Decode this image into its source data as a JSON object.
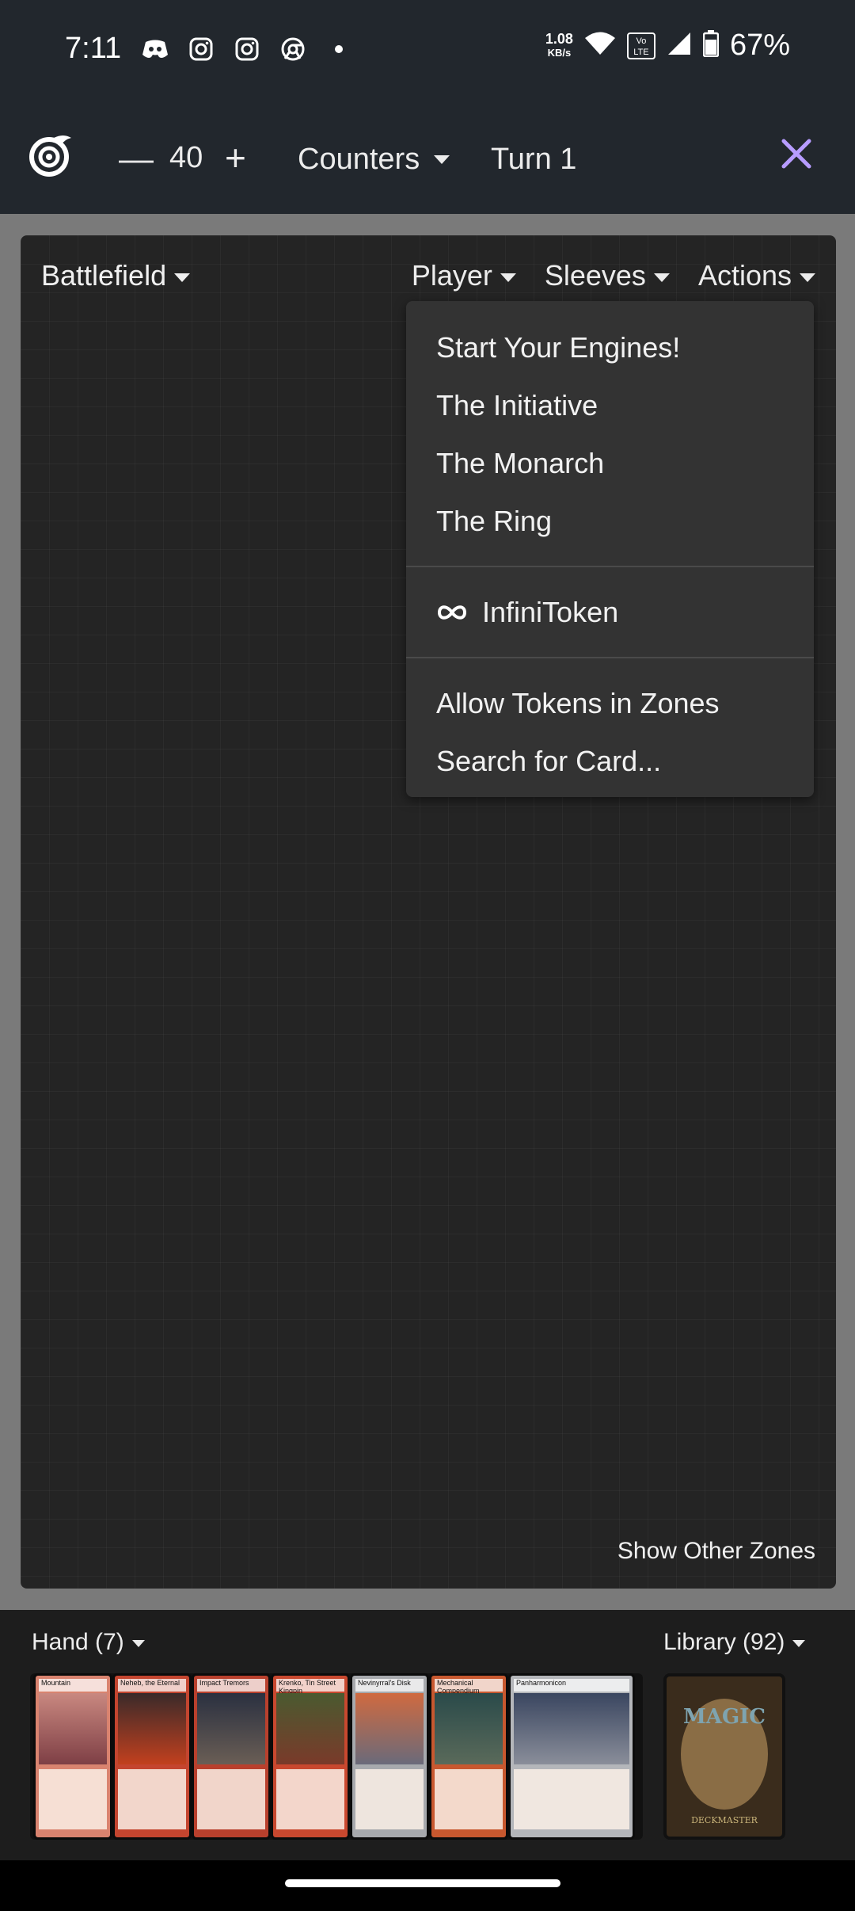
{
  "status_bar": {
    "time": "7:11",
    "app_icons": [
      "discord-icon",
      "instagram-icon",
      "instagram-icon",
      "chrome-icon",
      "dot-icon"
    ],
    "net_speed_value": "1.08",
    "net_speed_unit": "KB/s",
    "volte": "Vo LTE",
    "battery": "67%"
  },
  "toolbar": {
    "life_minus": "—",
    "life_total": "40",
    "life_plus": "+",
    "counters_label": "Counters",
    "turn_label": "Turn 1",
    "close_color": "#b79cff"
  },
  "board": {
    "zone": "Battlefield",
    "tabs": [
      "Player",
      "Sleeves",
      "Actions"
    ],
    "show_other_zones": "Show Other Zones"
  },
  "actions_menu": {
    "group1": [
      "Start Your Engines!",
      "The Initiative",
      "The Monarch",
      "The Ring"
    ],
    "infinitoken": "InfiniToken",
    "group3": [
      "Allow Tokens in Zones",
      "Search for Card..."
    ]
  },
  "hand": {
    "label": "Hand (7)",
    "cards": [
      {
        "name": "Mountain",
        "color": "#d9836f"
      },
      {
        "name": "Neheb, the Eternal",
        "color": "#c4452f"
      },
      {
        "name": "Impact Tremors",
        "color": "#b9402d"
      },
      {
        "name": "Krenko, Tin Street Kingpin",
        "color": "#c9482f"
      },
      {
        "name": "Nevinyrral's Disk",
        "color": "#a7a9ad"
      },
      {
        "name": "Mechanical Compendium",
        "color": "#c8582f"
      },
      {
        "name": "Panharmonicon",
        "color": "#b4b6ba"
      }
    ]
  },
  "library": {
    "label": "Library (92)",
    "logo_text": "MAGIC",
    "bottom_text": "DECKMASTER"
  }
}
